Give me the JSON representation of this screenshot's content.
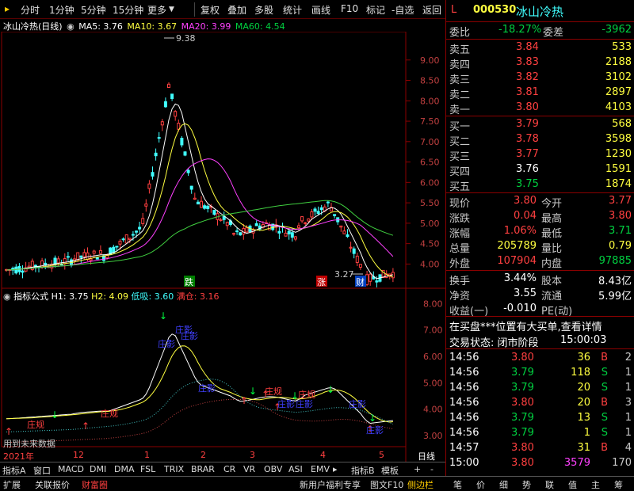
{
  "toolbar": {
    "left": [
      "分时",
      "1分钟",
      "5分钟",
      "15分钟",
      "更多"
    ],
    "right": [
      "复权",
      "叠加",
      "多股",
      "统计",
      "画线",
      "F10",
      "标记",
      "-自选",
      "返回"
    ]
  },
  "main_chart": {
    "stock_name": "冰山冷热(日线)",
    "ma5": "MA5: 3.76",
    "ma10": "MA10: 3.67",
    "ma20": "MA20: 3.99",
    "ma60": "MA60: 4.54",
    "high_label": "9.38",
    "low_label": "3.27",
    "y_ticks": [
      "9.00",
      "8.50",
      "8.00",
      "7.50",
      "7.00",
      "6.50",
      "6.00",
      "5.50",
      "5.00",
      "4.50",
      "4.00"
    ],
    "markers": {
      "die": "跌",
      "zhang": "涨",
      "cai": "财"
    }
  },
  "indicator": {
    "name": "指标公式",
    "h1": "H1: 3.75",
    "h2": "H2: 4.09",
    "dixi": "低吸: 3.60",
    "mancang": "满仓: 3.16",
    "y_ticks": [
      "8.00",
      "7.00",
      "6.00",
      "5.00",
      "4.00",
      "3.00"
    ],
    "future_note": "用到未来数据",
    "labels": {
      "zhuangying": "庄影",
      "zhuangying2": "庄影",
      "zhuangying3": "庄影",
      "zhuangying4": "庄影",
      "zhuangying5": "庄影",
      "zhuangying6": "庄影",
      "zhuangying7": "庄影",
      "zhuanggui1": "庄规",
      "zhuanggui2": "庄规",
      "zhuanggui3": "庄规",
      "zhuanggui4": "庄规",
      "zhuangyi": "庄影"
    }
  },
  "x_axis": {
    "labels": [
      "2021年",
      "12",
      "1",
      "2",
      "3",
      "4",
      "5"
    ],
    "period": "日线"
  },
  "bottom_tabs": [
    "指标A",
    "窗口",
    "MACD",
    "DMI",
    "DMA",
    "FSL",
    "TRIX",
    "BRAR",
    "CR",
    "VR",
    "OBV",
    "ASI",
    "EMV",
    "指标B",
    "模板",
    "+",
    "-"
  ],
  "footer": {
    "left": [
      "扩展",
      "关联报价",
      "财富圈"
    ],
    "right": [
      "新用户福利专享",
      "图文F10",
      "侧边栏"
    ],
    "icons": [
      "笔",
      "价",
      "细",
      "势",
      "联",
      "值",
      "主",
      "筹"
    ]
  },
  "quote": {
    "flag": "L",
    "code": "000530",
    "name": "冰山冷热",
    "weibi_label": "委比",
    "weibi": "-18.27%",
    "weicha_label": "委差",
    "weicha": "-3962",
    "sell": [
      {
        "label": "卖五",
        "price": "3.84",
        "vol": "533"
      },
      {
        "label": "卖四",
        "price": "3.83",
        "vol": "2188"
      },
      {
        "label": "卖三",
        "price": "3.82",
        "vol": "3102"
      },
      {
        "label": "卖二",
        "price": "3.81",
        "vol": "2897"
      },
      {
        "label": "卖一",
        "price": "3.80",
        "vol": "4103"
      }
    ],
    "buy": [
      {
        "label": "买一",
        "price": "3.79",
        "vol": "568"
      },
      {
        "label": "买二",
        "price": "3.78",
        "vol": "3598"
      },
      {
        "label": "买三",
        "price": "3.77",
        "vol": "1230"
      },
      {
        "label": "买四",
        "price": "3.76",
        "vol": "1591"
      },
      {
        "label": "买五",
        "price": "3.75",
        "vol": "1874"
      }
    ],
    "stats": [
      {
        "l1": "现价",
        "v1": "3.80",
        "l2": "今开",
        "v2": "3.77"
      },
      {
        "l1": "涨跌",
        "v1": "0.04",
        "l2": "最高",
        "v2": "3.80"
      },
      {
        "l1": "涨幅",
        "v1": "1.06%",
        "l2": "最低",
        "v2": "3.71"
      },
      {
        "l1": "总量",
        "v1": "205789",
        "l2": "量比",
        "v2": "0.79"
      },
      {
        "l1": "外盘",
        "v1": "107904",
        "l2": "内盘",
        "v2": "97885"
      }
    ],
    "stats2": [
      {
        "l1": "换手",
        "v1": "3.44%",
        "l2": "股本",
        "v2": "8.43亿"
      },
      {
        "l1": "净资",
        "v1": "3.55",
        "l2": "流通",
        "v2": "5.99亿"
      },
      {
        "l1": "收益(一)",
        "v1": "-0.010",
        "l2": "PE(动)",
        "v2": ""
      }
    ],
    "notice": "在买盘***位置有大买单,查看详情",
    "status_label": "交易状态: 闭市阶段",
    "status_time": "15:00:03",
    "ticks": [
      {
        "t": "14:56",
        "p": "3.80",
        "v": "36",
        "d": "B"
      },
      {
        "t": "14:56",
        "p": "3.79",
        "v": "118",
        "d": "S"
      },
      {
        "t": "14:56",
        "p": "3.79",
        "v": "20",
        "d": "S"
      },
      {
        "t": "14:56",
        "p": "3.80",
        "v": "20",
        "d": "B"
      },
      {
        "t": "14:56",
        "p": "3.79",
        "v": "13",
        "d": "S"
      },
      {
        "t": "14:56",
        "p": "3.79",
        "v": "1",
        "d": "S"
      },
      {
        "t": "14:57",
        "p": "3.80",
        "v": "31",
        "d": "B"
      },
      {
        "t": "15:00",
        "p": "3.80",
        "v": "3579",
        "d": "170"
      }
    ],
    "tick_suffix": [
      "2",
      "1",
      "1",
      "3",
      "1",
      "1",
      "4",
      ""
    ]
  },
  "colors": {
    "up": "#ff4040",
    "down": "#00d040",
    "ma5": "#ffffff",
    "ma10": "#ffff40",
    "ma20": "#ff40ff",
    "ma60": "#40d040"
  }
}
